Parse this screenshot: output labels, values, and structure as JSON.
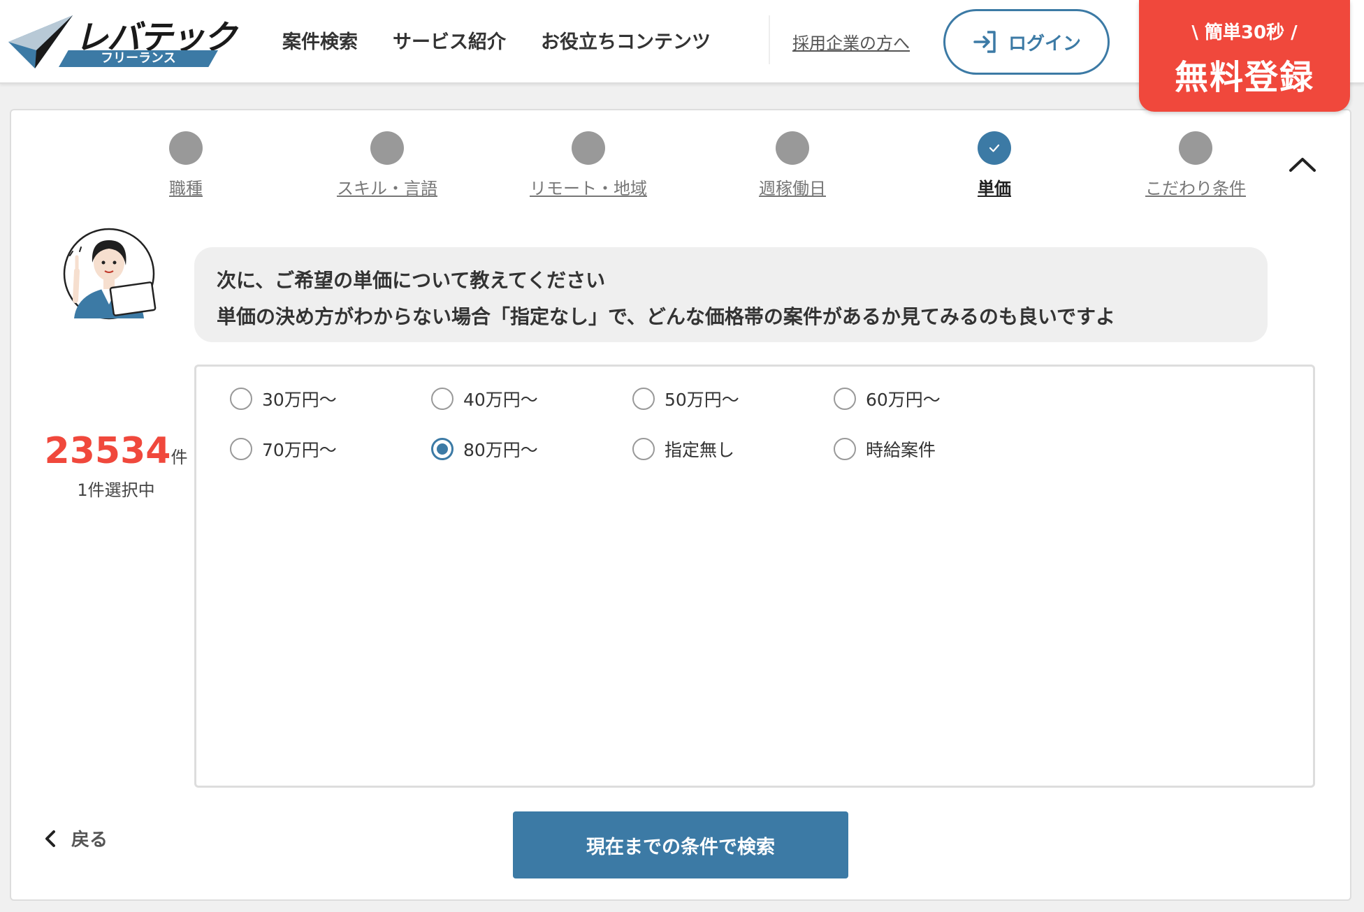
{
  "header": {
    "logo_text": "レバテック",
    "logo_sub": "フリーランス",
    "nav": [
      "案件検索",
      "サービス紹介",
      "お役立ちコンテンツ"
    ],
    "corp_link": "採用企業の方へ",
    "login_label": "ログイン",
    "register_sub": "\\ 簡単30秒 /",
    "register_main": "無料登録"
  },
  "steps": [
    {
      "label": "職種",
      "active": false
    },
    {
      "label": "スキル・言語",
      "active": false
    },
    {
      "label": "リモート・地域",
      "active": false
    },
    {
      "label": "週稼働日",
      "active": false
    },
    {
      "label": "単価",
      "active": true
    },
    {
      "label": "こだわり条件",
      "active": false
    }
  ],
  "message": {
    "line1": "次に、ご希望の単価について教えてください",
    "line2": "単価の決め方がわからない場合「指定なし」で、どんな価格帯の案件があるか見てみるのも良いですよ"
  },
  "count": {
    "number": "23534",
    "unit": "件",
    "selected": "1件選択中"
  },
  "options": [
    {
      "label": "30万円〜",
      "checked": false
    },
    {
      "label": "40万円〜",
      "checked": false
    },
    {
      "label": "50万円〜",
      "checked": false
    },
    {
      "label": "60万円〜",
      "checked": false
    },
    {
      "label": "70万円〜",
      "checked": false
    },
    {
      "label": "80万円〜",
      "checked": true
    },
    {
      "label": "指定無し",
      "checked": false
    },
    {
      "label": "時給案件",
      "checked": false
    }
  ],
  "footer": {
    "back_label": "戻る",
    "search_label": "現在までの条件で検索"
  },
  "colors": {
    "accent": "#3c7aa5",
    "register": "#f0483c",
    "count": "#f0483c"
  }
}
